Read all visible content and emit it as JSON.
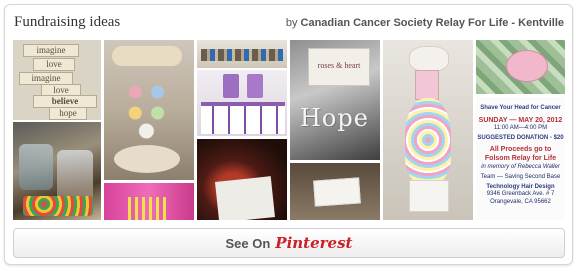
{
  "header": {
    "title": "Fundraising ideas",
    "by_prefix": "by",
    "author": "Canadian Cancer Society Relay For Life - Kentville"
  },
  "pins": {
    "word_blocks": [
      "imagine",
      "love",
      "imagine",
      "love",
      "believe",
      "hope"
    ],
    "box_label": "roses & heart",
    "hope_letters": "Hope",
    "flyer": {
      "line1": "Shave Your Head for Cancer",
      "date": "SUNDAY — MAY 20, 2012",
      "time": "11:00 AM—4:00 PM",
      "donation": "SUGGESTED DONATION - $20",
      "proceeds1": "All Proceeds go to",
      "proceeds2": "Folsom Relay for Life",
      "memory": "in memory of Rebecca Waller",
      "team": "Team — Saving Second Base",
      "venue": "Technology Hair Design",
      "street": "9346 Greenback Ave. # 7",
      "city": "Orangevale, CA 95662"
    }
  },
  "footer": {
    "see_on": "See On",
    "brand": "Pinterest"
  },
  "colors": {
    "brand_red": "#cb2027",
    "border": "#d6d6d6",
    "text": "#333333"
  }
}
